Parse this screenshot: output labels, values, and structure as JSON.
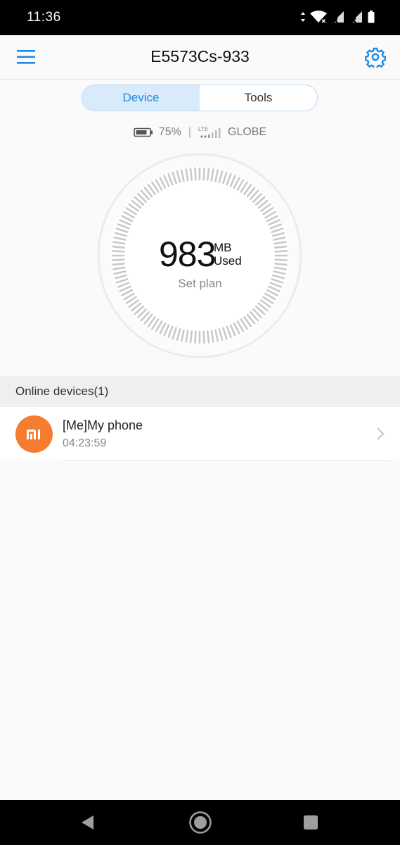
{
  "status_bar": {
    "time": "11:36"
  },
  "header": {
    "title": "E5573Cs-933",
    "menu_icon": "hamburger-menu-icon",
    "settings_icon": "gear-icon",
    "accent_color": "#1e88e5"
  },
  "tabs": [
    {
      "label": "Device",
      "active": true
    },
    {
      "label": "Tools",
      "active": false
    }
  ],
  "info": {
    "battery": "75%",
    "network_type": "LTE",
    "carrier": "GLOBE"
  },
  "usage": {
    "value": "983",
    "unit": "MB",
    "caption": "Used",
    "set_plan": "Set plan"
  },
  "online_devices": {
    "title": "Online devices(1)",
    "items": [
      {
        "name": "[Me]My phone",
        "duration": "04:23:59",
        "avatar_color": "#f47d31"
      }
    ]
  }
}
